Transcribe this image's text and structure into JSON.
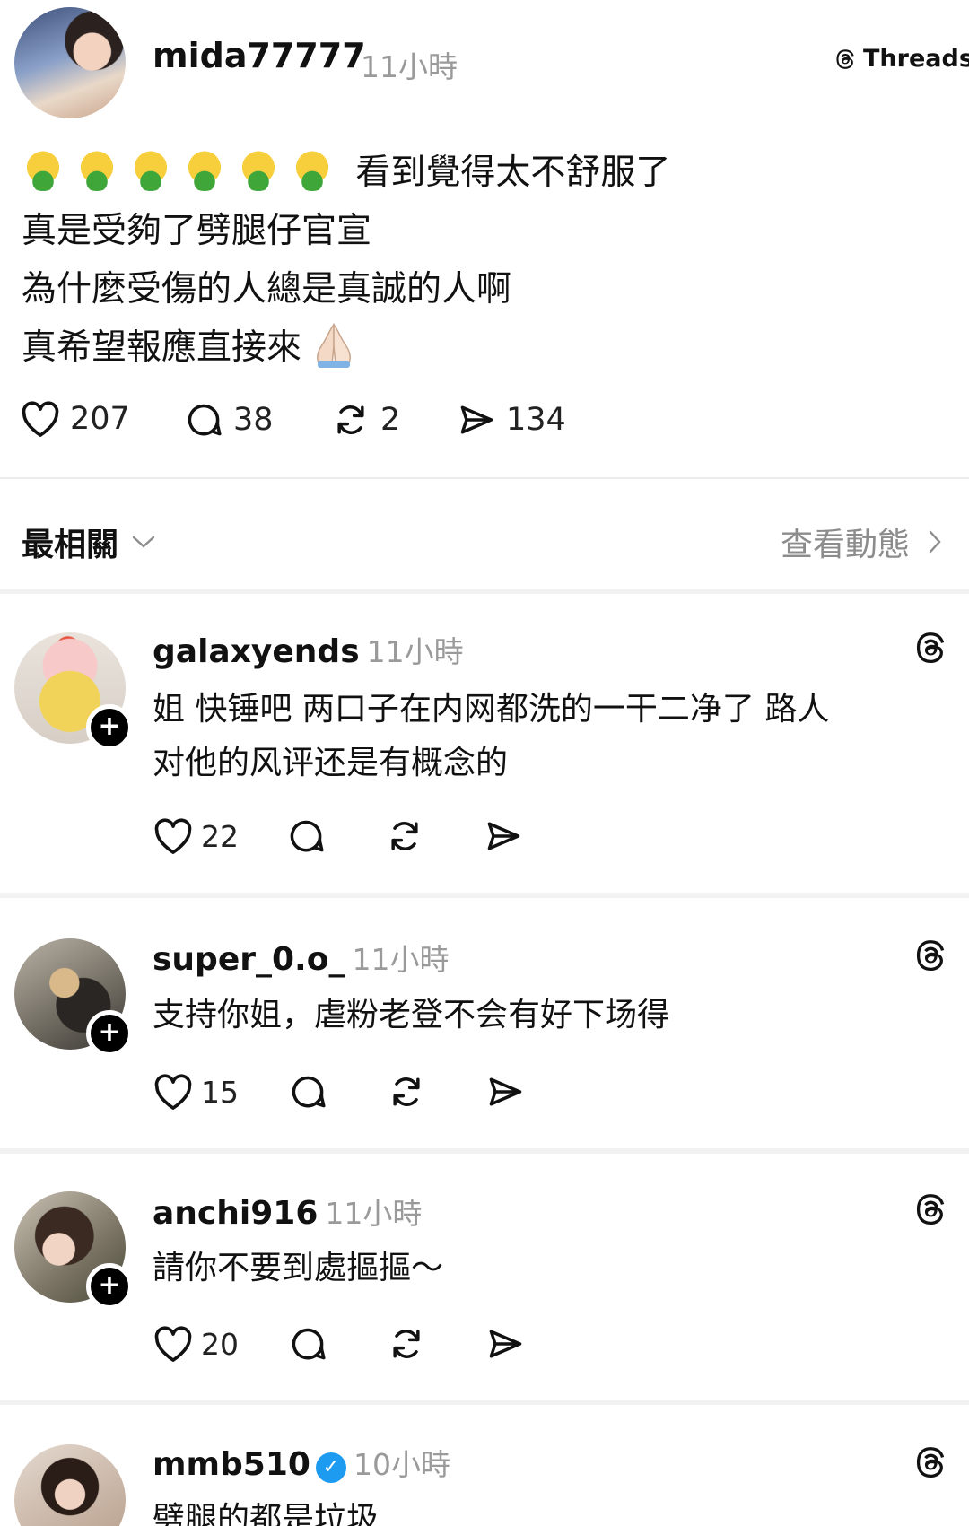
{
  "post": {
    "username": "mida77777",
    "time": "11小時",
    "brand": "Threads",
    "lines": [
      "看到覺得太不舒服了",
      "真是受夠了劈腿仔官宣",
      "為什麼受傷的人總是真誠的人啊",
      "真希望報應直接來"
    ],
    "emoji_count": 6,
    "emoji_first_line": "nauseated-face-icon",
    "emoji_last_line": "folded-hands-icon",
    "likes": "207",
    "replies": "38",
    "reposts": "2",
    "shares": "134"
  },
  "sort": {
    "label": "最相關",
    "activity_link": "查看動態"
  },
  "comments": [
    {
      "username": "galaxyends",
      "time": "11小時",
      "text": [
        "姐 快锤吧 两口子在内网都洗的一干二净了 路人",
        "对他的风评还是有概念的"
      ],
      "likes": "22"
    },
    {
      "username": "super_0.o_",
      "time": "11小時",
      "text": [
        "支持你姐，虐粉老登不会有好下场得"
      ],
      "likes": "15"
    },
    {
      "username": "anchi916",
      "time": "11小時",
      "text": [
        "請你不要到處摳摳～"
      ],
      "likes": "20"
    },
    {
      "username": "mmb510",
      "time": "10小時",
      "verified": true,
      "text": [
        "劈腿的都是垃圾"
      ],
      "likes": ""
    }
  ],
  "colors": {
    "text": "#111111",
    "muted": "#9a9a9a",
    "divider": "#ececec",
    "verified": "#1d9bf0"
  }
}
